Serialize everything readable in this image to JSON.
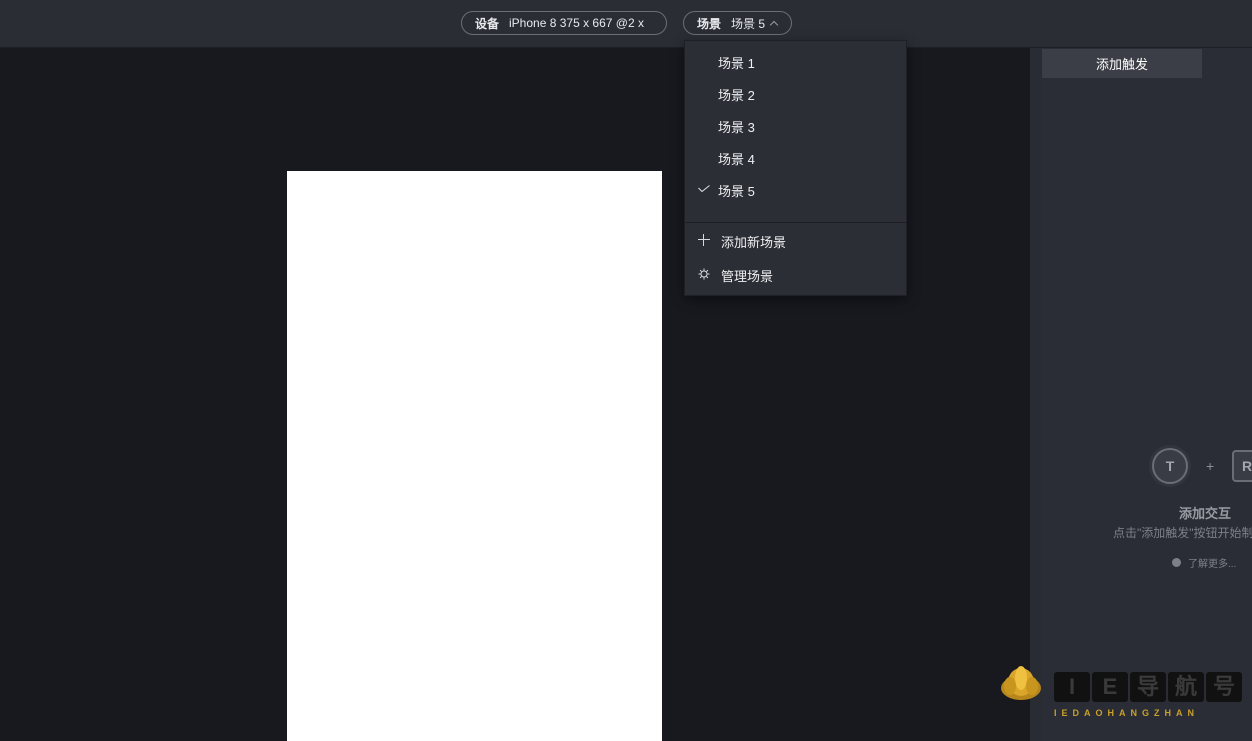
{
  "topbar": {
    "device_label": "设备",
    "device_value": "iPhone 8  375 x 667  @2 x",
    "scene_label": "场景",
    "scene_value": "场景 5"
  },
  "scene_menu": {
    "items": [
      {
        "label": "场景 1",
        "selected": false
      },
      {
        "label": "场景 2",
        "selected": false
      },
      {
        "label": "场景 3",
        "selected": false
      },
      {
        "label": "场景 4",
        "selected": false
      },
      {
        "label": "场景 5",
        "selected": true
      }
    ],
    "add_label": "添加新场景",
    "manage_label": "管理场景"
  },
  "right_panel": {
    "add_trigger_label": "添加触发",
    "illus_t": "T",
    "illus_r": "R",
    "empty_title": "添加交互",
    "empty_desc": "点击\"添加触发\"按钮开始制作",
    "learn_more": "了解更多..."
  },
  "watermark": {
    "chars": [
      "I",
      "E",
      "导",
      "航",
      "号"
    ],
    "subtitle": "IEDAOHANGZHAN"
  },
  "colors": {
    "topbar_bg": "#2b2d35",
    "canvas_bg": "#17191f",
    "panel_bg": "#2b2d36",
    "menu_bg": "#2c2e36",
    "watermark_gold": "#c8a02a"
  }
}
